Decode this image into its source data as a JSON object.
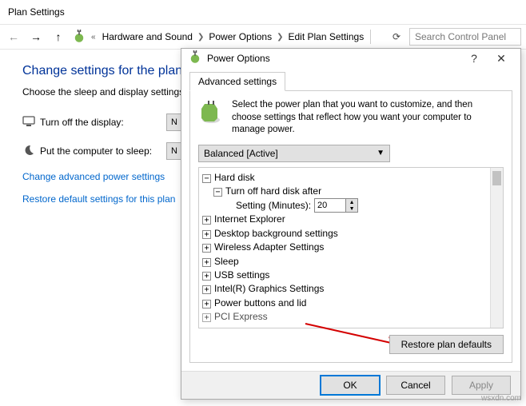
{
  "window": {
    "title": "Plan Settings"
  },
  "breadcrumb": {
    "items": [
      "Hardware and Sound",
      "Power Options",
      "Edit Plan Settings"
    ]
  },
  "search": {
    "placeholder": "Search Control Panel"
  },
  "page": {
    "heading": "Change settings for the plan",
    "subtext": "Choose the sleep and display settings",
    "display_label": "Turn off the display:",
    "sleep_label": "Put the computer to sleep:",
    "display_value": "N",
    "sleep_value": "N",
    "link_advanced": "Change advanced power settings",
    "link_restore": "Restore default settings for this plan"
  },
  "dialog": {
    "title": "Power Options",
    "tab": "Advanced settings",
    "intro": "Select the power plan that you want to customize, and then choose settings that reflect how you want your computer to manage power.",
    "plan": "Balanced [Active]",
    "tree": {
      "hard_disk": "Hard disk",
      "turn_off_hdd": "Turn off hard disk after",
      "setting_label": "Setting (Minutes):",
      "setting_value": "20",
      "ie": "Internet Explorer",
      "desktop": "Desktop background settings",
      "wireless": "Wireless Adapter Settings",
      "sleep": "Sleep",
      "usb": "USB settings",
      "intel": "Intel(R) Graphics Settings",
      "power_buttons": "Power buttons and lid",
      "pci": "PCI Express"
    },
    "restore_btn": "Restore plan defaults",
    "ok": "OK",
    "cancel": "Cancel",
    "apply": "Apply"
  },
  "watermark": "wsxdn.com"
}
